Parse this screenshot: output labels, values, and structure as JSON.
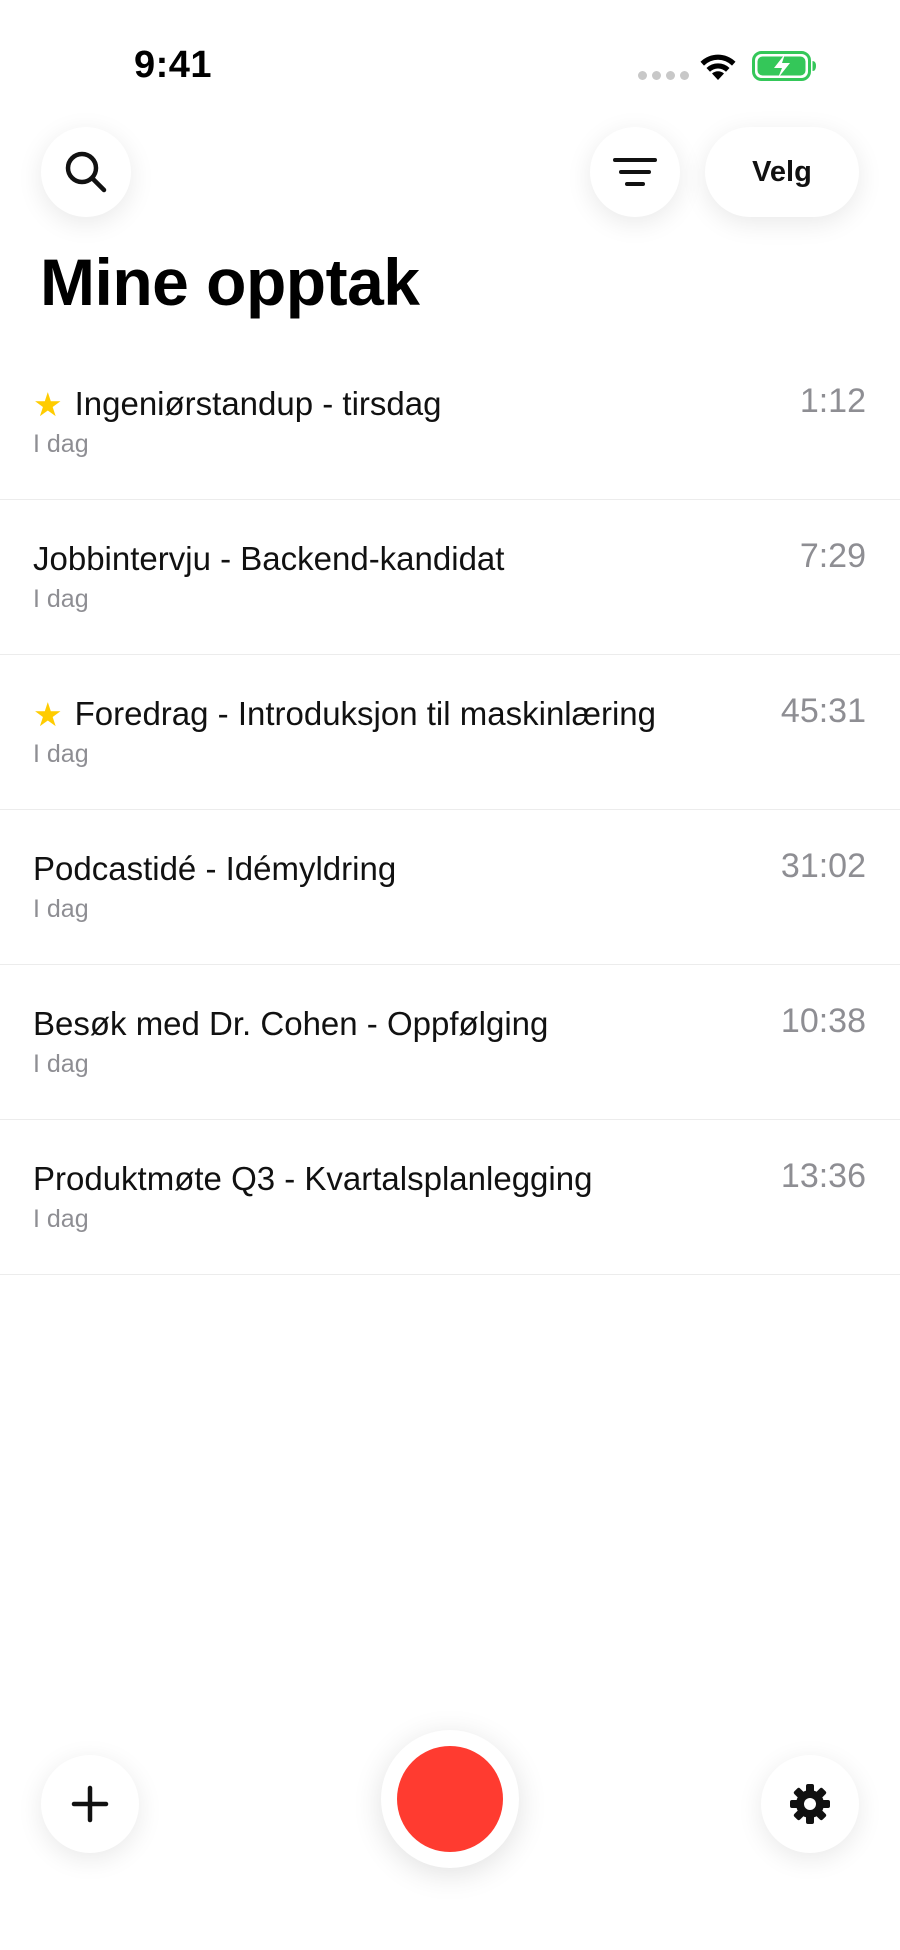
{
  "status_bar": {
    "time": "9:41"
  },
  "header": {
    "select_label": "Velg",
    "title": "Mine opptak"
  },
  "recordings": [
    {
      "title": "Ingeniørstandup - tirsdag",
      "date": "I dag",
      "duration": "1:12",
      "starred": true
    },
    {
      "title": "Jobbintervju - Backend-kandidat",
      "date": "I dag",
      "duration": "7:29",
      "starred": false
    },
    {
      "title": "Foredrag - Introduksjon til maskinlæring",
      "date": "I dag",
      "duration": "45:31",
      "starred": true
    },
    {
      "title": "Podcastidé - Idémyldring",
      "date": "I dag",
      "duration": "31:02",
      "starred": false
    },
    {
      "title": "Besøk med Dr. Cohen - Oppfølging",
      "date": "I dag",
      "duration": "10:38",
      "starred": false
    },
    {
      "title": "Produktmøte Q3 - Kvartalsplanlegging",
      "date": "I dag",
      "duration": "13:36",
      "starred": false
    }
  ],
  "icons": {
    "search": "search-icon",
    "filter": "filter-icon",
    "add": "plus-icon",
    "settings": "gear-icon",
    "record": "record-icon",
    "star": "star-icon"
  },
  "colors": {
    "record": "#ff3b30",
    "star": "#ffcc00",
    "battery": "#34c759",
    "secondary_text": "#8e8e93"
  }
}
